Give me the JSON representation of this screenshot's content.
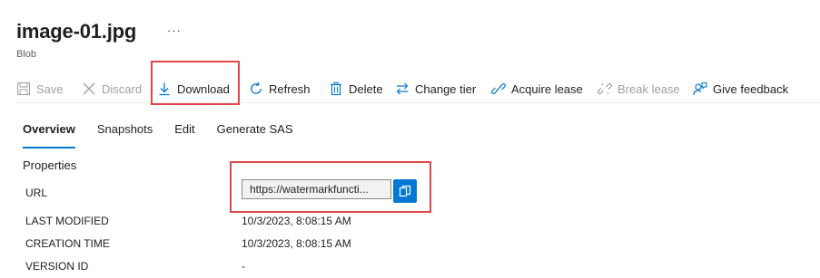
{
  "header": {
    "title": "image-01.jpg",
    "more": "···",
    "subtitle": "Blob"
  },
  "toolbar": {
    "save": "Save",
    "discard": "Discard",
    "download": "Download",
    "refresh": "Refresh",
    "delete": "Delete",
    "change_tier": "Change tier",
    "acquire_lease": "Acquire lease",
    "break_lease": "Break lease",
    "give_feedback": "Give feedback"
  },
  "tabs": [
    "Overview",
    "Snapshots",
    "Edit",
    "Generate SAS"
  ],
  "properties": {
    "section_title": "Properties",
    "url_label": "URL",
    "url_value": "https://watermarkfuncti...",
    "last_modified_label": "LAST MODIFIED",
    "last_modified_value": "10/3/2023, 8:08:15 AM",
    "creation_time_label": "CREATION TIME",
    "creation_time_value": "10/3/2023, 8:08:15 AM",
    "version_id_label": "VERSION ID",
    "version_id_value": "-"
  },
  "colors": {
    "accent": "#0078d4",
    "highlight": "#e0454a",
    "disabled": "#a19f9d"
  }
}
